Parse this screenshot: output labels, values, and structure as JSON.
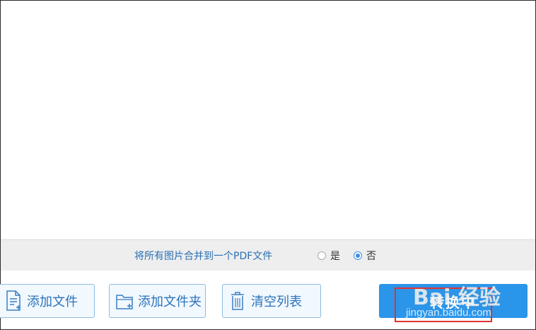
{
  "merge_bar": {
    "label": "将所有图片合并到一个PDF文件",
    "option_yes": "是",
    "option_no": "否",
    "selected": "否"
  },
  "toolbar": {
    "add_file_label": "添加文件",
    "add_folder_label": "添加文件夹",
    "clear_list_label": "清空列表",
    "convert_label": "转换中"
  },
  "watermark": {
    "logo_text": "Bai 经验",
    "url": "jingyan.baidu.com"
  },
  "colors": {
    "accent": "#2b95e9",
    "button_border": "#8fbbe0",
    "highlight": "#e03232"
  }
}
